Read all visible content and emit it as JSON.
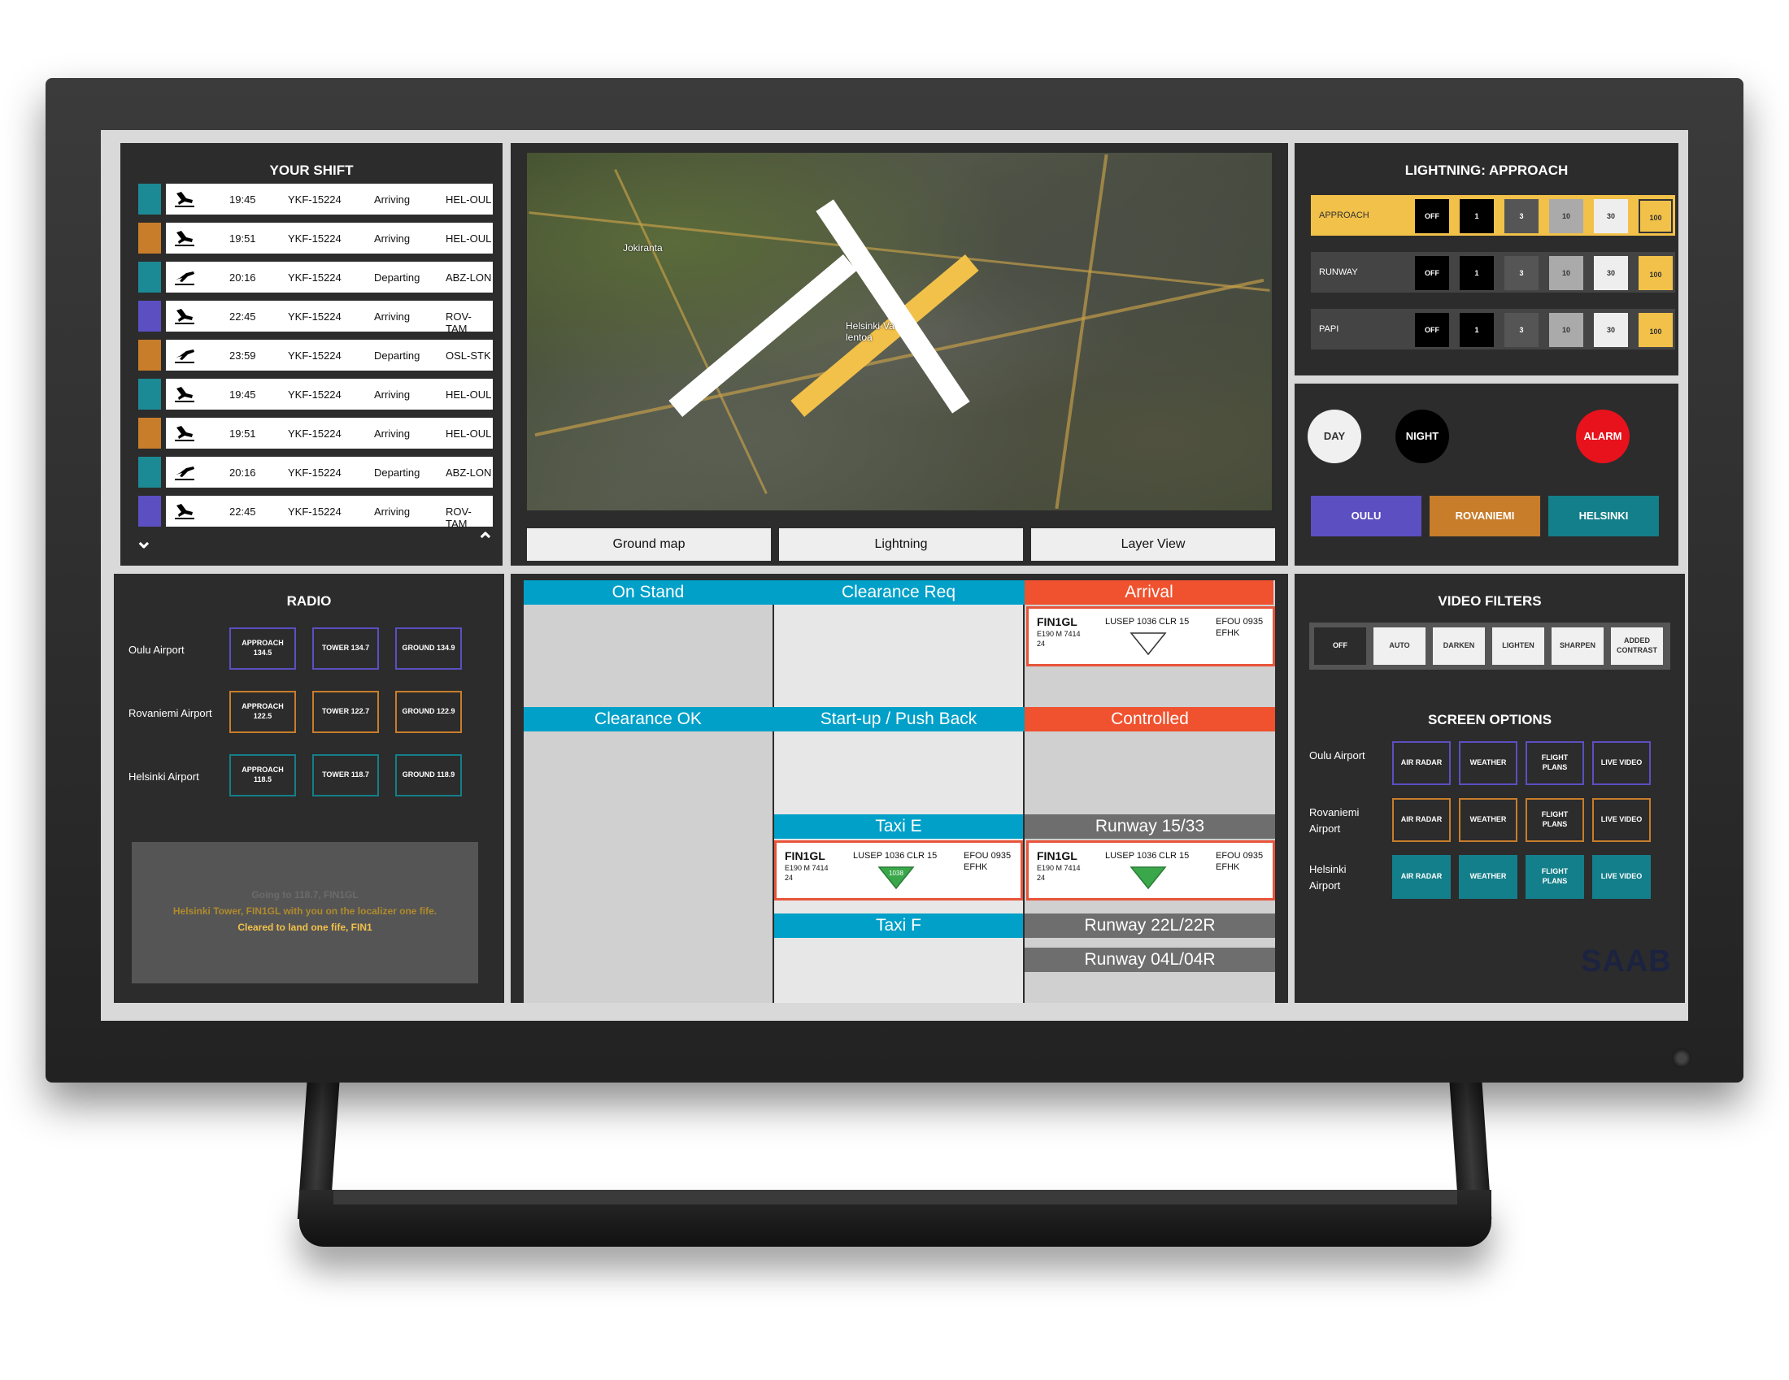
{
  "shift": {
    "title": "YOUR SHIFT",
    "rows": [
      {
        "time": "19:45",
        "flight": "YKF-15224",
        "status": "Arriving",
        "route": "HEL-OUL",
        "color": "#1c8a94",
        "dir": "arriving"
      },
      {
        "time": "19:51",
        "flight": "YKF-15224",
        "status": "Arriving",
        "route": "HEL-OUL",
        "color": "#c87d2a",
        "dir": "arriving"
      },
      {
        "time": "20:16",
        "flight": "YKF-15224",
        "status": "Departing",
        "route": "ABZ-LON",
        "color": "#1c8a94",
        "dir": "departing"
      },
      {
        "time": "22:45",
        "flight": "YKF-15224",
        "status": "Arriving",
        "route": "ROV-TAM",
        "color": "#5b4fc2",
        "dir": "arriving"
      },
      {
        "time": "23:59",
        "flight": "YKF-15224",
        "status": "Departing",
        "route": "OSL-STK",
        "color": "#c87d2a",
        "dir": "departing"
      },
      {
        "time": "19:45",
        "flight": "YKF-15224",
        "status": "Arriving",
        "route": "HEL-OUL",
        "color": "#1c8a94",
        "dir": "arriving"
      },
      {
        "time": "19:51",
        "flight": "YKF-15224",
        "status": "Arriving",
        "route": "HEL-OUL",
        "color": "#c87d2a",
        "dir": "arriving"
      },
      {
        "time": "20:16",
        "flight": "YKF-15224",
        "status": "Departing",
        "route": "ABZ-LON",
        "color": "#1c8a94",
        "dir": "departing"
      },
      {
        "time": "22:45",
        "flight": "YKF-15224",
        "status": "Arriving",
        "route": "ROV-TAM",
        "color": "#5b4fc2",
        "dir": "arriving"
      }
    ]
  },
  "map": {
    "labels": {
      "place1": "Jokiranta",
      "airport": "Helsinki-Va lentoa"
    },
    "tabs": {
      "ground": "Ground map",
      "lightning": "Lightning",
      "layer": "Layer View"
    }
  },
  "lightning": {
    "title": "LIGHTNING: APPROACH",
    "rows": [
      {
        "label": "APPROACH",
        "active": true
      },
      {
        "label": "RUNWAY",
        "active": false
      },
      {
        "label": "PAPI",
        "active": false
      }
    ],
    "levels": [
      "OFF",
      "1",
      "3",
      "10",
      "30",
      "100"
    ]
  },
  "modes": {
    "day": "DAY",
    "night": "NIGHT",
    "alarm": "ALARM",
    "airports": [
      {
        "label": "OULU",
        "color": "#5b4fc2"
      },
      {
        "label": "ROVANIEMI",
        "color": "#c87d2a"
      },
      {
        "label": "HELSINKI",
        "color": "#137f8a"
      }
    ]
  },
  "radio": {
    "title": "RADIO",
    "airports": [
      {
        "name": "Oulu Airport",
        "approach_l1": "APPROACH",
        "approach_l2": "134.5",
        "tower": "TOWER 134.7",
        "ground": "GROUND 134.9",
        "color": "#5b4fc2"
      },
      {
        "name": "Rovaniemi Airport",
        "approach_l1": "APPROACH",
        "approach_l2": "122.5",
        "tower": "TOWER 122.7",
        "ground": "GROUND 122.9",
        "color": "#c87d2a"
      },
      {
        "name": "Helsinki Airport",
        "approach_l1": "APPROACH",
        "approach_l2": "118.5",
        "tower": "TOWER 118.7",
        "ground": "GROUND 118.9",
        "color": "#137f8a"
      }
    ],
    "transcript": [
      "Going to 118.7, FIN1GL",
      "Helsinki Tower, FIN1GL with you on the localizer one fife.",
      "Cleared to land one fife, FIN1"
    ]
  },
  "board": {
    "headers": {
      "on_stand": "On Stand",
      "clearance_req": "Clearance Req",
      "arrival": "Arrival",
      "clearance_ok": "Clearance OK",
      "startup": "Start-up / Push Back",
      "controlled": "Controlled",
      "taxi_e": "Taxi E",
      "runway_1533": "Runway 15/33",
      "taxi_f": "Taxi F",
      "runway_22": "Runway 22L/22R",
      "runway_04": "Runway 04L/04R"
    },
    "strips": {
      "arrival": {
        "callsign": "FIN1GL",
        "type": "E190 M 7414",
        "sub": "24",
        "squawk": "LUSEP 1036",
        "clr": "CLR 15",
        "dest": "EFOU 0935",
        "arr": "EFHK",
        "marker": ""
      },
      "taxi_e": {
        "callsign": "FIN1GL",
        "type": "E190 M 7414",
        "sub": "24",
        "squawk": "LUSEP 1036",
        "clr": "CLR 15",
        "dest": "EFOU 0935",
        "arr": "EFHK",
        "marker": "1038"
      },
      "runway": {
        "callsign": "FIN1GL",
        "type": "E190 M 7414",
        "sub": "24",
        "squawk": "LUSEP 1036",
        "clr": "CLR 15",
        "dest": "EFOU 0935",
        "arr": "EFHK",
        "marker": ""
      }
    }
  },
  "video": {
    "title": "VIDEO FILTERS",
    "filters": [
      "OFF",
      "AUTO",
      "DARKEN",
      "LIGHTEN",
      "SHARPEN",
      "ADDED CONTRAST"
    ]
  },
  "screen_options": {
    "title": "SCREEN OPTIONS",
    "airports": [
      {
        "name_l1": "Oulu Airport",
        "name_l2": "",
        "color": "#5b4fc2",
        "filled": false
      },
      {
        "name_l1": "Rovaniemi",
        "name_l2": "Airport",
        "color": "#c87d2a",
        "filled": false
      },
      {
        "name_l1": "Helsinki",
        "name_l2": "Airport",
        "color": "#137f8a",
        "filled": true
      }
    ],
    "options": {
      "radar": "AIR RADAR",
      "weather": "WEATHER",
      "flight_l1": "FLIGHT",
      "flight_l2": "PLANS",
      "video": "LIVE VIDEO"
    }
  },
  "brand": "SAAB",
  "colors": {
    "accent_blue": "#00a0c8",
    "accent_red": "#f0512e",
    "accent_gray": "#6e6e6e",
    "accent_yellow": "#f2c14a"
  }
}
